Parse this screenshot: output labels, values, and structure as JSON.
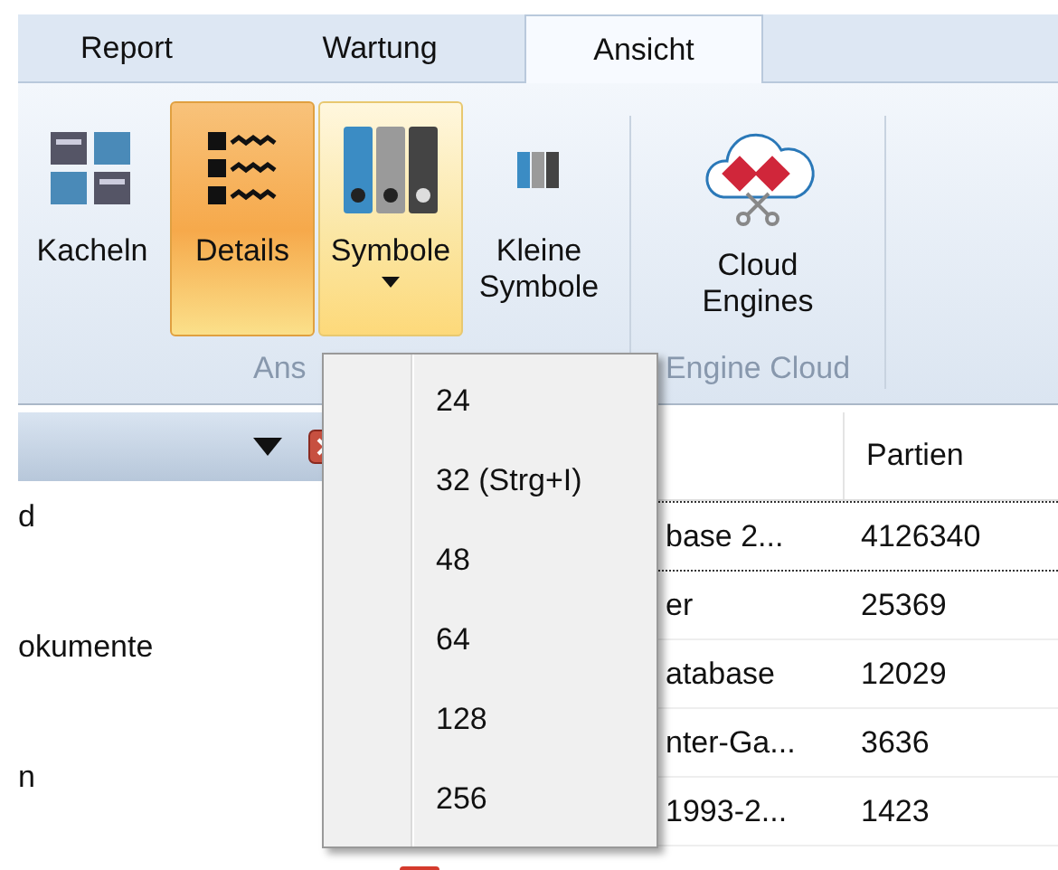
{
  "tabs": [
    {
      "label": "Report",
      "selected": false
    },
    {
      "label": "Wartung",
      "selected": false
    },
    {
      "label": "Ansicht",
      "selected": true
    }
  ],
  "ribbon": {
    "groups": [
      {
        "label": "Ans",
        "buttons": [
          {
            "kind": "tiles",
            "label": "Kacheln",
            "selected": false,
            "dropdown": false
          },
          {
            "kind": "details",
            "label": "Details",
            "selected": true,
            "dropdown": false
          },
          {
            "kind": "binders",
            "label": "Symbole",
            "selected": false,
            "dropdown": true,
            "expanded": true
          },
          {
            "kind": "small",
            "label": "Kleine Symbole",
            "selected": false,
            "dropdown": false
          }
        ]
      },
      {
        "label": "Engine Cloud",
        "buttons": [
          {
            "kind": "cloud",
            "label": "Cloud Engines",
            "selected": false,
            "dropdown": false
          }
        ]
      }
    ]
  },
  "left_panel": {
    "items": [
      "d",
      "okumente",
      "n"
    ]
  },
  "table": {
    "columns": [
      "Partien"
    ],
    "rows": [
      {
        "column_1": "base 2...",
        "partien": "4126340"
      },
      {
        "column_1": "er",
        "partien": "25369"
      },
      {
        "column_1": "atabase",
        "partien": "12029"
      },
      {
        "column_1": "nter-Ga...",
        "partien": "3636"
      },
      {
        "column_1": "1993-2...",
        "partien": "1423"
      }
    ]
  },
  "menu": {
    "items": [
      {
        "label": "24"
      },
      {
        "label": "32 (Strg+I)"
      },
      {
        "label": "48"
      },
      {
        "label": "64"
      },
      {
        "label": "128"
      },
      {
        "label": "256"
      }
    ]
  }
}
